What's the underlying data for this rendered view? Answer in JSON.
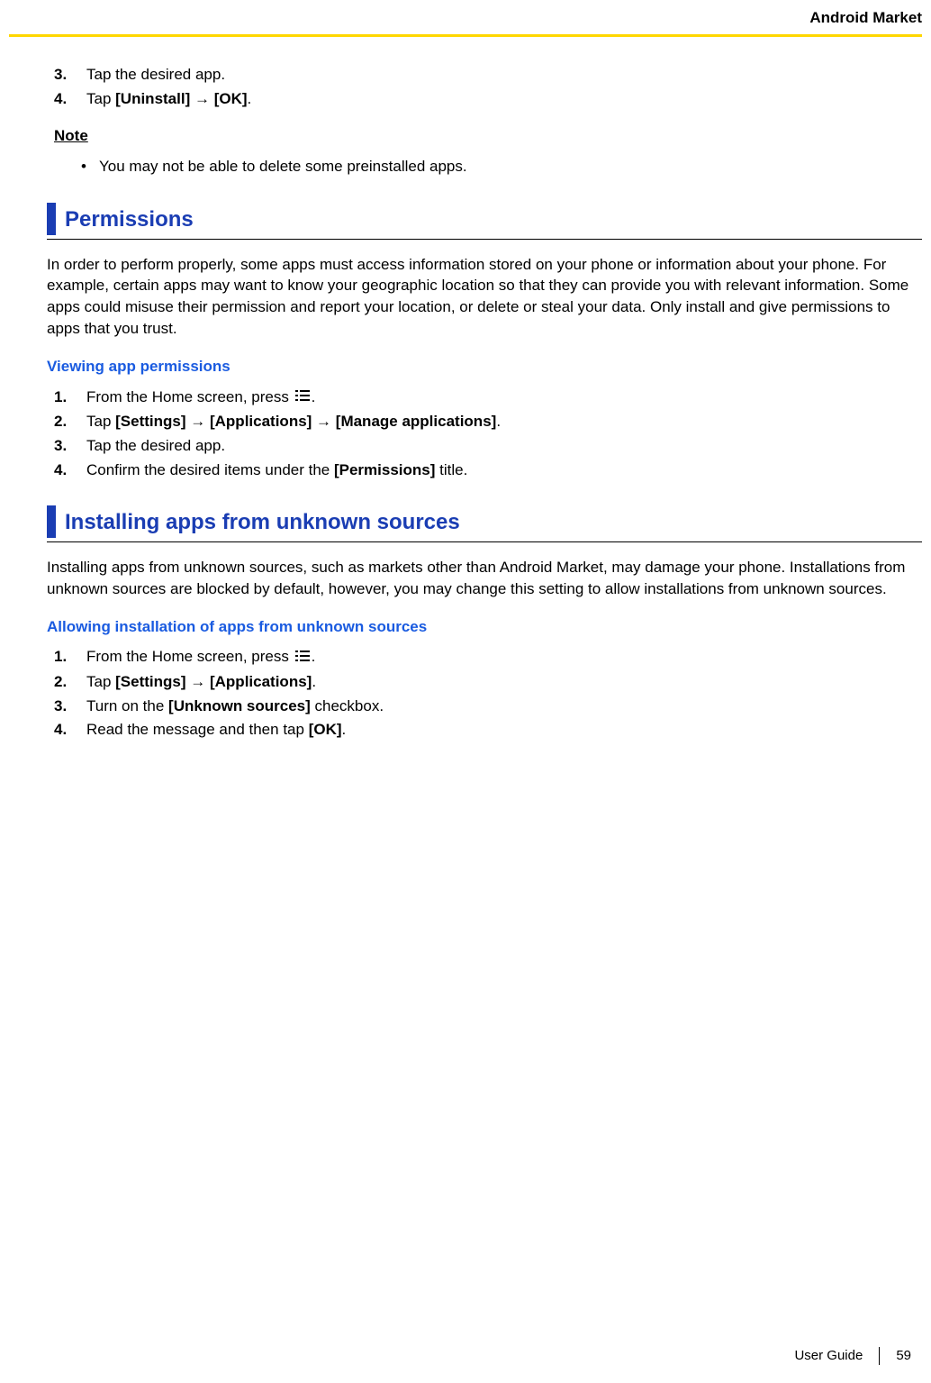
{
  "header": {
    "title": "Android Market"
  },
  "top_steps": [
    {
      "num": "3.",
      "parts": [
        {
          "t": "Tap the desired app."
        }
      ]
    },
    {
      "num": "4.",
      "parts": [
        {
          "t": "Tap "
        },
        {
          "t": "[Uninstall]",
          "b": true
        },
        {
          "t": " → ",
          "arrow": true
        },
        {
          "t": "[OK]",
          "b": true
        },
        {
          "t": "."
        }
      ]
    }
  ],
  "note": {
    "label": "Note",
    "bullets": [
      [
        {
          "t": "You may not be able to delete some preinstalled apps."
        }
      ]
    ]
  },
  "section1": {
    "title": "Permissions",
    "para": "In order to perform properly, some apps must access information stored on your phone or information about your phone. For example, certain apps may want to know your geographic location so that they can provide you with relevant information. Some apps could misuse their permission and report your location, or delete or steal your data. Only install and give permissions to apps that you trust.",
    "sub": "Viewing app permissions",
    "steps": [
      {
        "num": "1.",
        "parts": [
          {
            "t": "From the Home screen, press "
          },
          {
            "icon": "menu"
          },
          {
            "t": "."
          }
        ]
      },
      {
        "num": "2.",
        "parts": [
          {
            "t": "Tap "
          },
          {
            "t": "[Settings]",
            "b": true
          },
          {
            "t": " → ",
            "arrow": true
          },
          {
            "t": "[Applications]",
            "b": true
          },
          {
            "t": " → ",
            "arrow": true
          },
          {
            "t": "[Manage applications]",
            "b": true
          },
          {
            "t": "."
          }
        ]
      },
      {
        "num": "3.",
        "parts": [
          {
            "t": "Tap the desired app."
          }
        ]
      },
      {
        "num": "4.",
        "parts": [
          {
            "t": "Confirm the desired items under the "
          },
          {
            "t": "[Permissions]",
            "b": true
          },
          {
            "t": " title."
          }
        ]
      }
    ]
  },
  "section2": {
    "title": "Installing apps from unknown sources",
    "para": "Installing apps from unknown sources, such as markets other than Android Market, may damage your phone. Installations from unknown sources are blocked by default, however, you may change this setting to allow installations from unknown sources.",
    "sub": "Allowing installation of apps from unknown sources",
    "steps": [
      {
        "num": "1.",
        "parts": [
          {
            "t": "From the Home screen, press "
          },
          {
            "icon": "menu"
          },
          {
            "t": "."
          }
        ]
      },
      {
        "num": "2.",
        "parts": [
          {
            "t": "Tap "
          },
          {
            "t": "[Settings]",
            "b": true
          },
          {
            "t": " → ",
            "arrow": true
          },
          {
            "t": "[Applications]",
            "b": true
          },
          {
            "t": "."
          }
        ]
      },
      {
        "num": "3.",
        "parts": [
          {
            "t": "Turn on the "
          },
          {
            "t": "[Unknown sources]",
            "b": true
          },
          {
            "t": " checkbox."
          }
        ]
      },
      {
        "num": "4.",
        "parts": [
          {
            "t": "Read the message and then tap "
          },
          {
            "t": "[OK]",
            "b": true
          },
          {
            "t": "."
          }
        ]
      }
    ]
  },
  "footer": {
    "label": "User Guide",
    "page": "59"
  }
}
